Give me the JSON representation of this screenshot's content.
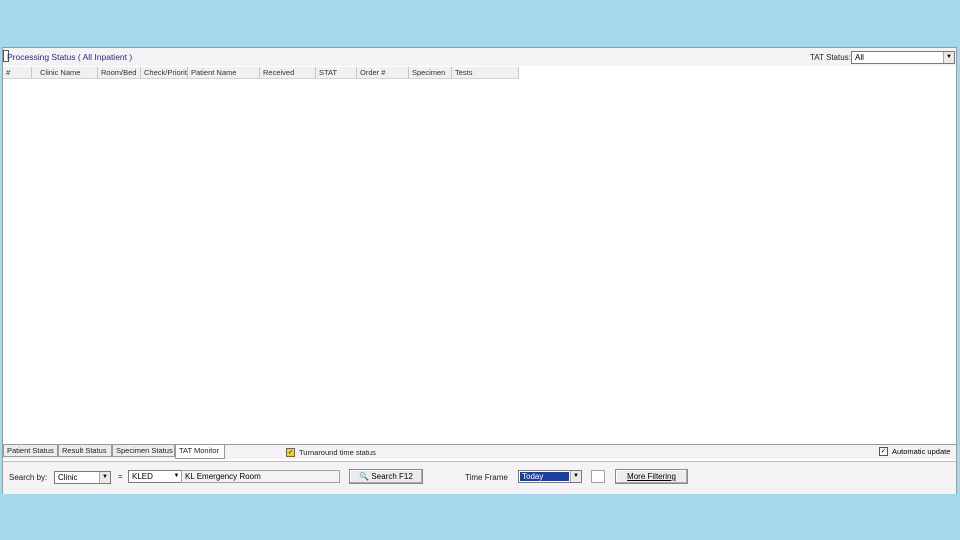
{
  "window": {
    "title": "Processing Status ( All Inpatient )",
    "tat_status_label": "TAT Status:",
    "tat_status_value": "All"
  },
  "grid": {
    "columns": [
      "#",
      "Clinic Name",
      "Room/Bed",
      "Check/Priority",
      "Patient Name",
      "Received",
      "STAT",
      "Order #",
      "Specimen",
      "Tests"
    ]
  },
  "tabs": [
    {
      "label": "Patient Status"
    },
    {
      "label": "Result Status"
    },
    {
      "label": "Specimen Status"
    },
    {
      "label": "TAT Monitor"
    }
  ],
  "legend": {
    "label": "Turnaround time status"
  },
  "auto_update": {
    "label": "Automatic update",
    "checked": true
  },
  "search": {
    "search_by_label": "Search by:",
    "search_by_value": "Clinic",
    "equals_symbol": "=",
    "code_value": "KLED",
    "description_value": "KL Emergency Room",
    "search_button": "Search F12"
  },
  "time_frame": {
    "label": "Time Frame",
    "value": "Today",
    "more_filtering_button": "More Filtering"
  }
}
